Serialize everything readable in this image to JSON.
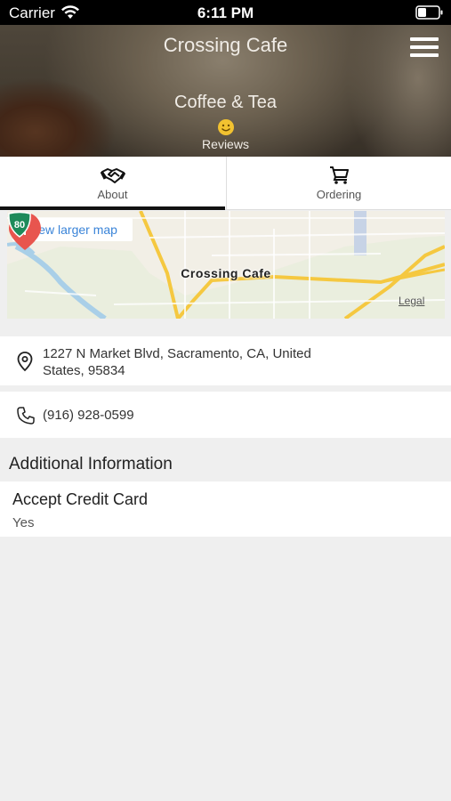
{
  "status_bar": {
    "carrier": "Carrier",
    "time": "6:11 PM"
  },
  "header": {
    "title": "Crossing Cafe",
    "category": "Coffee & Tea",
    "reviews_label": "Reviews"
  },
  "tabs": [
    {
      "label": "About",
      "icon": "handshake-icon",
      "active": true
    },
    {
      "label": "Ordering",
      "icon": "cart-icon",
      "active": false
    }
  ],
  "map": {
    "view_larger_label": "View larger map",
    "place_label": "Crossing Cafe",
    "shield_number": "80",
    "legal_label": "Legal",
    "pin_color": "#e8554e"
  },
  "contact": {
    "address_line1": "1227 N Market Blvd, Sacramento, CA, United",
    "address_line2": "States, 95834",
    "phone": "(916) 928-0599"
  },
  "additional_info": {
    "section_title": "Additional Information",
    "items": [
      {
        "label": "Accept Credit Card",
        "value": "Yes"
      }
    ]
  }
}
